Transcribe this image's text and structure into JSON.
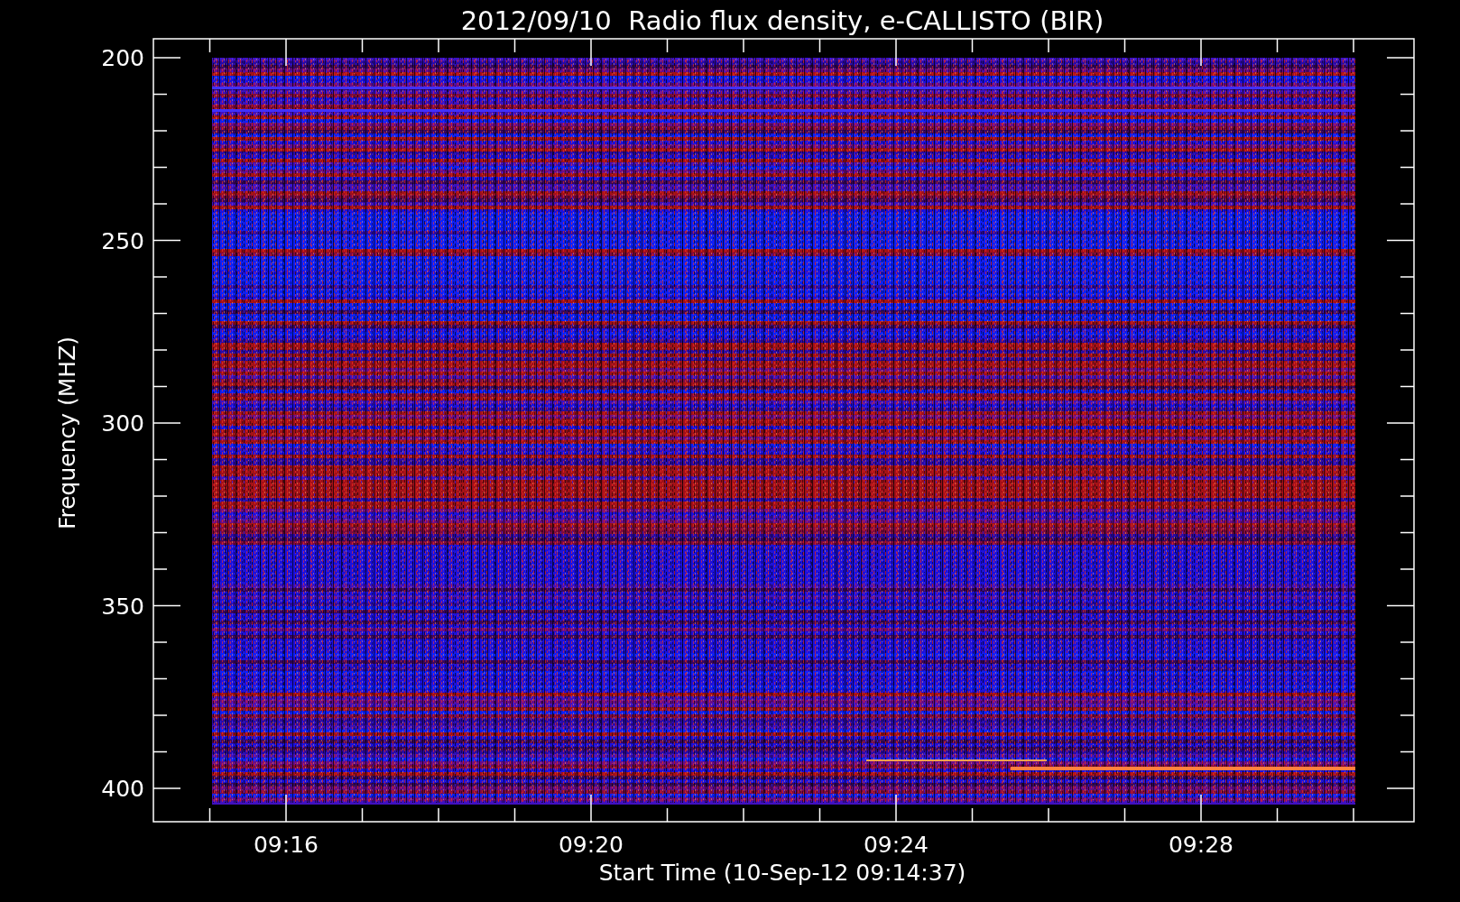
{
  "title": "2012/09/10  Radio flux density, e-CALLISTO (BIR)",
  "y_axis": {
    "label": "Frequency (MHZ)",
    "ticks": [
      "200",
      "250",
      "300",
      "350",
      "400"
    ]
  },
  "x_axis": {
    "label": "Start Time (10-Sep-12 09:14:37)",
    "ticks": [
      "09:16",
      "09:20",
      "09:24",
      "09:28"
    ]
  }
}
